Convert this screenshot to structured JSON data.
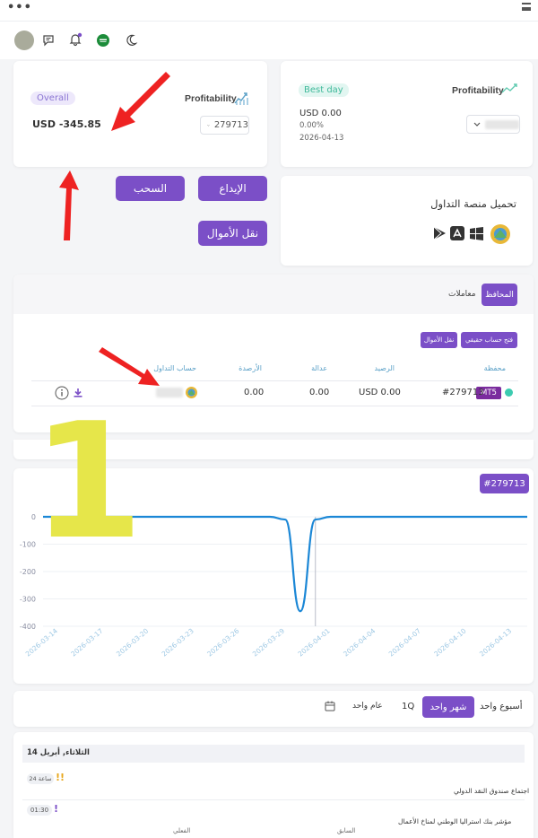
{
  "header": {
    "menu_dots": "•••"
  },
  "icons": {
    "chat": "chat-icon",
    "bell": "bell-icon",
    "flag": "saudi-flag-icon",
    "moon": "moon-icon",
    "menu": "hamburger-menu-icon"
  },
  "overall_card": {
    "badge": "Overall",
    "title": "Profitability",
    "balance": "USD -345.85",
    "account_select": "279713"
  },
  "best_day_card": {
    "badge": "Best day",
    "title": "Profitability",
    "amount": "USD 0.00",
    "percent": "0.00%",
    "date": "2026-04-13"
  },
  "actions": {
    "withdraw": "السحب",
    "deposit": "الإيداع",
    "transfer": "نقل الأموال"
  },
  "platforms": {
    "title": "تحميل منصة التداول",
    "icons": [
      "metatrader-icon",
      "windows-icon",
      "appstore-icon",
      "googleplay-icon"
    ]
  },
  "wallets": {
    "tab_active": "المحافظ",
    "tab_other": "معاملات",
    "btn_open_real": "فتح حساب حقيقي",
    "btn_transfer": "نقل الأموال",
    "columns": [
      "محفظة",
      "الرصيد",
      "عدالة",
      "الأرصدة",
      "حساب التداول"
    ],
    "row": {
      "account": "#279713",
      "platform": "MT5",
      "balance": "USD 0.00",
      "equity": "0.00",
      "credits": "0.00"
    }
  },
  "chart_data": {
    "type": "line",
    "account_label": "#279713",
    "x": [
      "2026-03-14",
      "2026-03-17",
      "2026-03-20",
      "2026-03-23",
      "2026-03-26",
      "2026-03-29",
      "2026-04-01",
      "2026-04-04",
      "2026-04-07",
      "2026-04-10",
      "2026-04-13"
    ],
    "y_ticks": [
      0,
      -100,
      -200,
      -300,
      -400
    ],
    "ylim": [
      -400,
      0
    ],
    "series": [
      {
        "values": [
          [
            "2026-03-14",
            0
          ],
          [
            "2026-03-29",
            0
          ],
          [
            "2026-03-30",
            -10
          ],
          [
            "2026-03-31",
            -345
          ],
          [
            "2026-04-01",
            -10
          ],
          [
            "2026-04-02",
            0
          ],
          [
            "2026-04-15",
            0
          ]
        ]
      }
    ],
    "line_color": "#1b87d6"
  },
  "period_tabs": [
    "أسبوع واحد",
    "شهر واحد",
    "1Q",
    "عام واحد"
  ],
  "period_active": "شهر واحد",
  "calendar": {
    "day_header": "الثلاثاء, أبريل 14",
    "events": [
      {
        "time": "24 ساعة",
        "title": "اجتماع صندوق النقد الدولي"
      },
      {
        "time": "01:30",
        "title": "مؤشر بنك استراليا الوطني لمناخ الأعمال"
      }
    ],
    "col_actual": "الفعلي",
    "col_previous": "السابق"
  },
  "overlay": {
    "big_number": "1"
  },
  "colors": {
    "accent": "#7b4fc7",
    "red_arrow": "#ee2222",
    "yellow_number": "#e6e64a",
    "chart_line": "#1b87d6"
  }
}
